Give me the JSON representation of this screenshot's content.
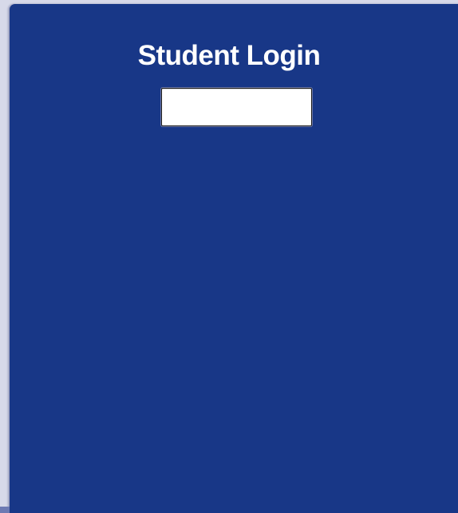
{
  "login": {
    "title": "Student Login",
    "input_value": "",
    "input_placeholder": ""
  },
  "colors": {
    "panel_background": "#183787",
    "title_text": "#ffffff",
    "input_background": "#ffffff"
  }
}
